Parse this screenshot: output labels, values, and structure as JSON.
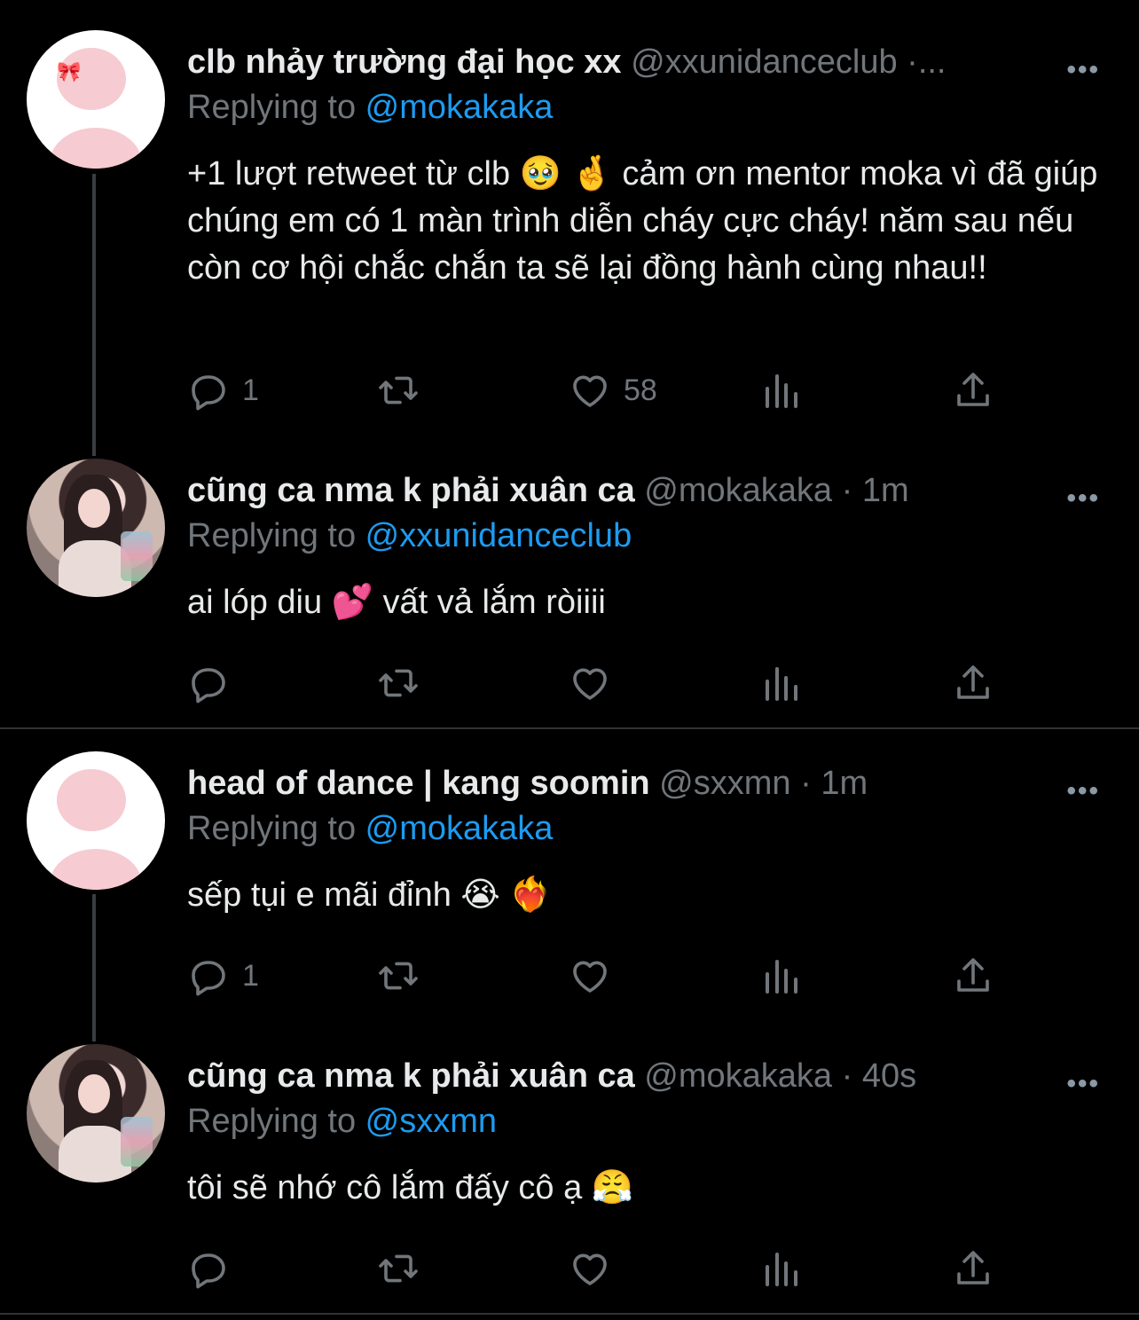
{
  "tweets": [
    {
      "name": "clb nhảy trường đại học xx",
      "handle": "@xxunidanceclub",
      "meta": " ·...",
      "replying_label": "Replying to ",
      "replying_to": "@mokakaka",
      "text": "+1 lượt retweet từ clb 🥹 🤞  cảm ơn mentor moka vì đã giúp chúng em có 1 màn trình diễn cháy cực cháy! năm sau nếu còn cơ hội chắc chắn ta sẽ lại đồng hành cùng nhau!!",
      "reply_count": "1",
      "retweet_count": "",
      "like_count": "58",
      "more": "•••"
    },
    {
      "name": "cũng ca nma k phải xuân ca",
      "handle": "@mokakaka",
      "meta": " · 1m",
      "replying_label": "Replying to ",
      "replying_to": "@xxunidanceclub",
      "text": "ai lóp diu 💕  vất vả lắm ròiiii",
      "reply_count": "",
      "retweet_count": "",
      "like_count": "",
      "more": "•••"
    },
    {
      "name": "head of dance | kang soomin",
      "handle": "@sxxmn",
      "meta": " · 1m",
      "replying_label": "Replying to ",
      "replying_to": "@mokakaka",
      "text": "sếp tụi e mãi đỉnh 😭 ❤️‍🔥",
      "reply_count": "1",
      "retweet_count": "",
      "like_count": "",
      "more": "•••"
    },
    {
      "name": "cũng ca nma k phải xuân ca",
      "handle": "@mokakaka",
      "meta": " · 40s",
      "replying_label": "Replying to ",
      "replying_to": "@sxxmn",
      "text": "tôi sẽ nhớ cô lắm đấy cô ạ 😤",
      "reply_count": "",
      "retweet_count": "",
      "like_count": "",
      "more": "•••"
    }
  ],
  "colors": {
    "background": "#000000",
    "text": "#e7e9ea",
    "muted": "#71767b",
    "link": "#1d9bf0",
    "avatar_pink": "#f6cbd1"
  },
  "icons": [
    "reply-icon",
    "retweet-icon",
    "like-icon",
    "analytics-icon",
    "share-icon",
    "more-icon"
  ]
}
